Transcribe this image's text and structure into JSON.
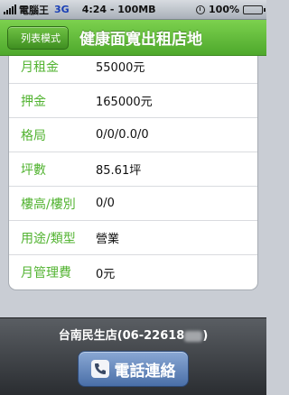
{
  "status_bar": {
    "carrier": "電腦王",
    "network": "3G",
    "time_text": "4:24 - 100MB",
    "battery": "100%",
    "battery_level": 1.0,
    "icons": [
      "signal-icon",
      "alarm-icon",
      "battery-icon"
    ]
  },
  "nav": {
    "back_label": "列表模式",
    "title": "健康面寬出租店地"
  },
  "details": [
    {
      "label": "月租金",
      "value": "55000元"
    },
    {
      "label": "押金",
      "value": "165000元"
    },
    {
      "label": "格局",
      "value": "0/0/0.0/0"
    },
    {
      "label": "坪數",
      "value": "85.61坪"
    },
    {
      "label": "樓高/樓別",
      "value": "0/0"
    },
    {
      "label": "用途/類型",
      "value": "營業"
    },
    {
      "label": "月管理費",
      "value": "0元"
    }
  ],
  "footer": {
    "store_prefix": "台南民生店(06-22618",
    "store_suffix": ")",
    "call_label": "電話連絡",
    "call_icon": "phone-icon"
  },
  "colors": {
    "accent_green": "#52b331",
    "nav_green": "#5fb83a",
    "call_blue": "#5b7fb8"
  }
}
